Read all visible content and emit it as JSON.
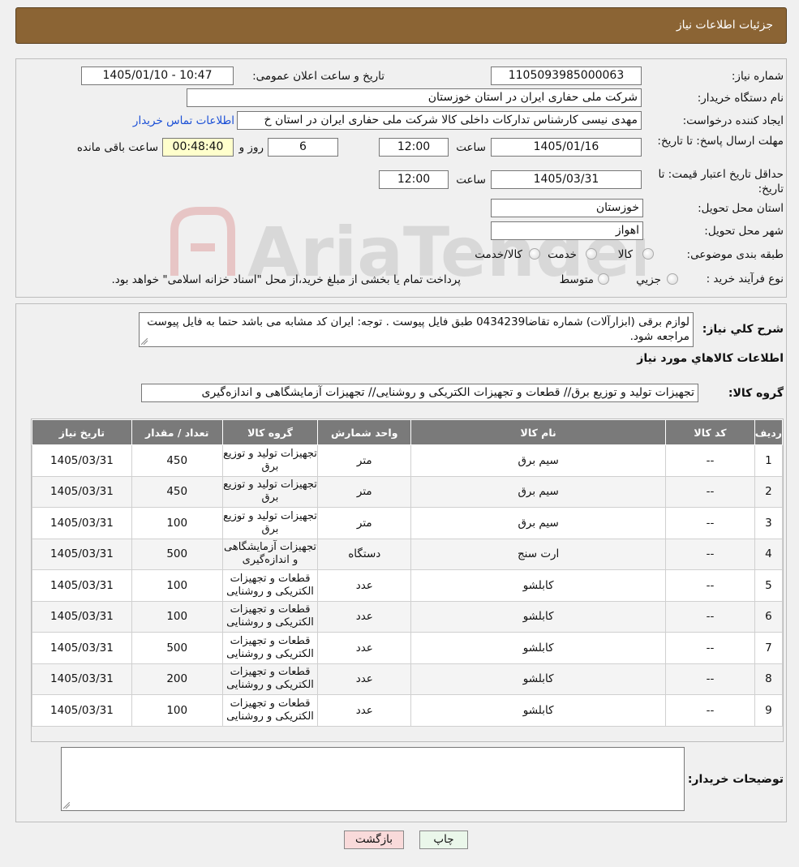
{
  "header": {
    "title": "جزئیات اطلاعات نیاز"
  },
  "form": {
    "need_number_label": "شماره نیاز:",
    "need_number": "1105093985000063",
    "announce_label": "تاریخ و ساعت اعلان عمومی:",
    "announce_value": "1405/01/10 - 10:47",
    "buyer_org_label": "نام دستگاه خریدار:",
    "buyer_org": "شرکت ملی حفاری ایران در استان خوزستان",
    "creator_label": "ایجاد کننده درخواست:",
    "creator": "مهدی نیسی کارشناس تدارکات داخلی کالا شرکت ملی حفاری ایران در استان خ",
    "contact_link": "اطلاعات تماس خریدار",
    "deadline_label": "مهلت ارسال پاسخ: تا تاریخ:",
    "deadline_date": "1405/01/16",
    "time_label": "ساعت",
    "deadline_time": "12:00",
    "days_value": "6",
    "days_label": "روز و",
    "remaining_value": "00:48:40",
    "remaining_label": "ساعت باقی مانده",
    "validity_label": "حداقل تاریخ اعتبار قیمت: تا تاریخ:",
    "validity_date": "1405/03/31",
    "validity_time": "12:00",
    "province_label": "استان محل تحویل:",
    "province": "خوزستان",
    "city_label": "شهر محل تحویل:",
    "city": "اهواز",
    "category_label": "طبقه بندی موضوعی:",
    "category_options": [
      "کالا",
      "خدمت",
      "کالا/خدمت"
    ],
    "purchase_label": "نوع فرآیند خرید :",
    "purchase_options": [
      "جزیي",
      "متوسط"
    ],
    "purchase_note": "پرداخت تمام یا بخشی از مبلغ خرید،از محل \"اسناد خزانه اسلامی\" خواهد بود."
  },
  "details": {
    "summary_label": "شرح کلي نياز:",
    "summary_text": "لوازم برقی (ابزارآلات)  شماره تقاضا0434239 طبق فایل پیوست . توجه: ایران کد مشابه می باشد حتما به فایل پیوست مراجعه شود.",
    "goods_info_title": "اطلاعات کالاهاي مورد نياز",
    "goods_group_label": "گروه کالا:",
    "goods_group": "تجهیزات تولید و توزیع برق// قطعات و تجهیزات الکتریکی و روشنایی// تجهیزات آزمایشگاهی و اندازه‌گیری"
  },
  "table": {
    "headers": [
      "رديف",
      "کد کالا",
      "نام کالا",
      "واحد شمارش",
      "گروه کالا",
      "تعداد / مقدار",
      "تاریخ نیاز"
    ],
    "rows": [
      [
        "1",
        "--",
        "سیم برق",
        "متر",
        "تجهیزات تولید و توزیع برق",
        "450",
        "1405/03/31"
      ],
      [
        "2",
        "--",
        "سیم برق",
        "متر",
        "تجهیزات تولید و توزیع برق",
        "450",
        "1405/03/31"
      ],
      [
        "3",
        "--",
        "سیم برق",
        "متر",
        "تجهیزات تولید و توزیع برق",
        "100",
        "1405/03/31"
      ],
      [
        "4",
        "--",
        "ارت سنج",
        "دستگاه",
        "تجهیزات آزمایشگاهی و اندازه‌گیری",
        "500",
        "1405/03/31"
      ],
      [
        "5",
        "--",
        "کابلشو",
        "عدد",
        "قطعات و تجهیزات الکتریکی و روشنایی",
        "100",
        "1405/03/31"
      ],
      [
        "6",
        "--",
        "کابلشو",
        "عدد",
        "قطعات و تجهیزات الکتریکی و روشنایی",
        "100",
        "1405/03/31"
      ],
      [
        "7",
        "--",
        "کابلشو",
        "عدد",
        "قطعات و تجهیزات الکتریکی و روشنایی",
        "500",
        "1405/03/31"
      ],
      [
        "8",
        "--",
        "کابلشو",
        "عدد",
        "قطعات و تجهیزات الکتریکی و روشنایی",
        "200",
        "1405/03/31"
      ],
      [
        "9",
        "--",
        "کابلشو",
        "عدد",
        "قطعات و تجهیزات الکتریکی و روشنایی",
        "100",
        "1405/03/31"
      ]
    ]
  },
  "buyer_notes": {
    "label": "توضیحات خریدار:",
    "value": ""
  },
  "buttons": {
    "print": "چاپ",
    "back": "بازگشت"
  },
  "watermark": {
    "text": "AriaTender.neT"
  },
  "colors": {
    "header_bg": "#8b6434",
    "table_header_bg": "#7a7a7a",
    "link": "#1a4fd6",
    "back_button_bg": "#f9dada",
    "print_button_bg": "#eaf7ea"
  }
}
